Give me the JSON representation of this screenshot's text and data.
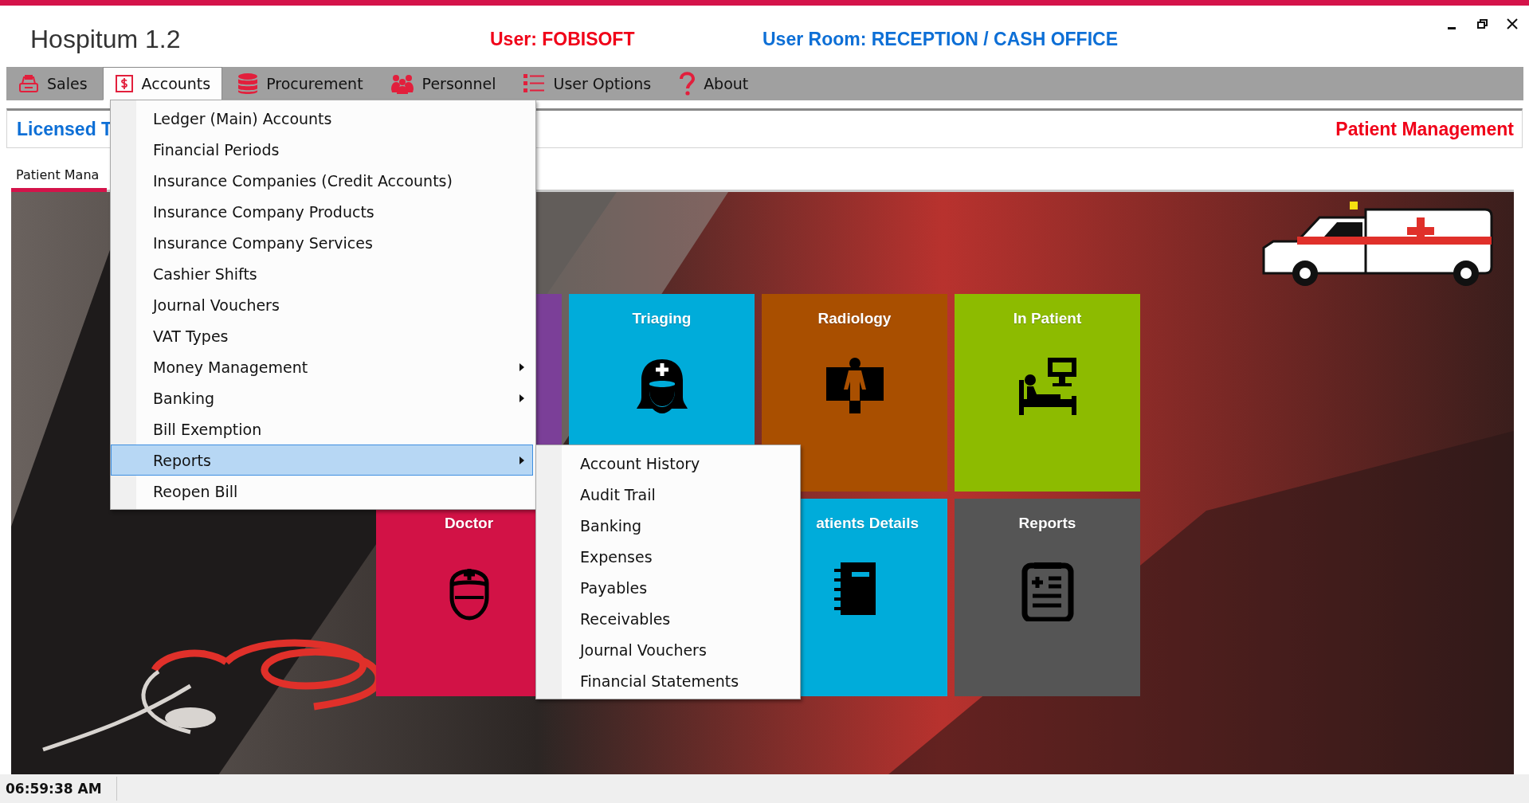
{
  "window": {
    "title": "Hospitum 1.2"
  },
  "header": {
    "user": "User: FOBISOFT",
    "room": "User Room: RECEPTION / CASH OFFICE"
  },
  "menu": [
    {
      "label": "Sales",
      "selected": false
    },
    {
      "label": "Accounts",
      "selected": true
    },
    {
      "label": "Procurement",
      "selected": false
    },
    {
      "label": "Personnel",
      "selected": false
    },
    {
      "label": "User Options",
      "selected": false
    },
    {
      "label": "About",
      "selected": false
    }
  ],
  "info_bar": {
    "license": "Licensed T",
    "module": "Patient Management"
  },
  "tab": {
    "label": "Patient Mana"
  },
  "tiles": [
    {
      "color": "#7b3f98"
    },
    {
      "title": "Triaging",
      "color": "#00acda"
    },
    {
      "title": "Radiology",
      "color": "#a94f00"
    },
    {
      "title": "In Patient",
      "color": "#8dbb00"
    },
    {
      "title": "Doctor",
      "color": "#d21246"
    },
    {
      "title": "atients Details",
      "color": "#00acda"
    },
    {
      "title": "Reports",
      "color": "#555555"
    }
  ],
  "accounts_menu": [
    {
      "label": "Ledger (Main) Accounts",
      "has_submenu": false,
      "selected": false
    },
    {
      "label": "Financial Periods",
      "has_submenu": false,
      "selected": false
    },
    {
      "label": "Insurance Companies (Credit Accounts)",
      "has_submenu": false,
      "selected": false
    },
    {
      "label": "Insurance Company Products",
      "has_submenu": false,
      "selected": false
    },
    {
      "label": "Insurance Company Services",
      "has_submenu": false,
      "selected": false
    },
    {
      "label": "Cashier Shifts",
      "has_submenu": false,
      "selected": false
    },
    {
      "label": "Journal Vouchers",
      "has_submenu": false,
      "selected": false
    },
    {
      "label": "VAT Types",
      "has_submenu": false,
      "selected": false
    },
    {
      "label": "Money Management",
      "has_submenu": true,
      "selected": false
    },
    {
      "label": "Banking",
      "has_submenu": true,
      "selected": false
    },
    {
      "label": "Bill Exemption",
      "has_submenu": false,
      "selected": false
    },
    {
      "label": "Reports",
      "has_submenu": true,
      "selected": true
    },
    {
      "label": "Reopen Bill",
      "has_submenu": false,
      "selected": false
    }
  ],
  "reports_submenu": [
    "Account History",
    "Audit Trail",
    "Banking",
    "Expenses",
    "Payables",
    "Receivables",
    "Journal Vouchers",
    "Financial Statements"
  ],
  "status_bar": {
    "time": "06:59:38 AM"
  }
}
